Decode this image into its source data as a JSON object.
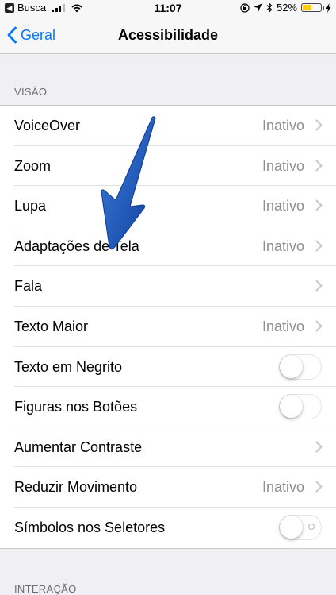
{
  "status_bar": {
    "back_app": "Busca",
    "time": "11:07",
    "battery": "52%",
    "battery_level": 0.52,
    "battery_color": "#ffcc00"
  },
  "nav": {
    "back_label": "Geral",
    "title": "Acessibilidade"
  },
  "section": {
    "header": "VISÃO",
    "rows": [
      {
        "label": "VoiceOver",
        "value": "Inativo",
        "type": "disclosure"
      },
      {
        "label": "Zoom",
        "value": "Inativo",
        "type": "disclosure"
      },
      {
        "label": "Lupa",
        "value": "Inativo",
        "type": "disclosure"
      },
      {
        "label": "Adaptações de Tela",
        "value": "Inativo",
        "type": "disclosure"
      },
      {
        "label": "Fala",
        "value": "",
        "type": "disclosure"
      },
      {
        "label": "Texto Maior",
        "value": "Inativo",
        "type": "disclosure"
      },
      {
        "label": "Texto em Negrito",
        "type": "toggle",
        "on": false
      },
      {
        "label": "Figuras nos Botões",
        "type": "toggle",
        "on": false
      },
      {
        "label": "Aumentar Contraste",
        "value": "",
        "type": "disclosure"
      },
      {
        "label": "Reduzir Movimento",
        "value": "Inativo",
        "type": "disclosure"
      },
      {
        "label": "Símbolos nos Seletores",
        "type": "toggle",
        "on": false,
        "labels": true
      }
    ]
  },
  "next_section_header": "INTERAÇÃO",
  "colors": {
    "accent": "#007aff",
    "annotation_arrow": "#1a55b8"
  }
}
